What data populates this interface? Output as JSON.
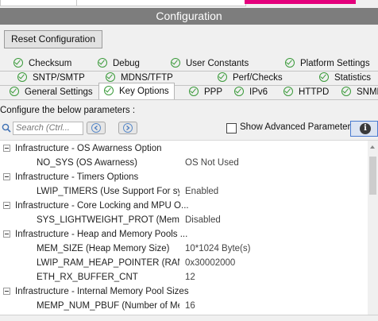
{
  "window": {
    "title": "Configuration"
  },
  "toolbar": {
    "reset_label": "Reset Configuration"
  },
  "tabs": {
    "row1": [
      "Checksum",
      "Debug",
      "User Constants",
      "Platform Settings"
    ],
    "row2": [
      "SNTP/SMTP",
      "MDNS/TFTP",
      "Perf/Checks",
      "Statistics"
    ],
    "row3": [
      "General Settings",
      "Key Options",
      "PPP",
      "IPv6",
      "HTTPD",
      "SNMP"
    ],
    "active": "Key Options"
  },
  "params": {
    "heading": "Configure the below parameters :",
    "search_placeholder": "Search (Ctrl...",
    "show_advanced_label": "Show Advanced Parameters",
    "show_advanced_checked": false,
    "info_icon": "i"
  },
  "tree": [
    {
      "type": "group",
      "label": "Infrastructure - OS Awarness Option"
    },
    {
      "type": "param",
      "name": "NO_SYS (OS Awarness)",
      "value": "OS Not Used"
    },
    {
      "type": "group",
      "label": "Infrastructure - Timers Options"
    },
    {
      "type": "param",
      "name": "LWIP_TIMERS (Use Support For sy...",
      "value": "Enabled"
    },
    {
      "type": "group",
      "label": "Infrastructure - Core Locking and MPU O..."
    },
    {
      "type": "param",
      "name": "SYS_LIGHTWEIGHT_PROT (Memory...",
      "value": "Disabled"
    },
    {
      "type": "group",
      "label": "Infrastructure - Heap and Memory Pools ..."
    },
    {
      "type": "param",
      "name": "MEM_SIZE (Heap Memory Size)",
      "value": "10*1024 Byte(s)"
    },
    {
      "type": "param",
      "name": "LWIP_RAM_HEAP_POINTER (RAM ...",
      "value": "0x30002000"
    },
    {
      "type": "param",
      "name": "ETH_RX_BUFFER_CNT",
      "value": "12"
    },
    {
      "type": "group",
      "label": "Infrastructure - Internal Memory Pool Sizes"
    },
    {
      "type": "param",
      "name": "MEMP_NUM_PBUF (Number of Mem...",
      "value": "16"
    }
  ],
  "colors": {
    "titlebar": "#7d7d7d",
    "check_green": "#3a9a3a",
    "accent_pink": "#e4007c",
    "info_border": "#4a7bd0"
  }
}
